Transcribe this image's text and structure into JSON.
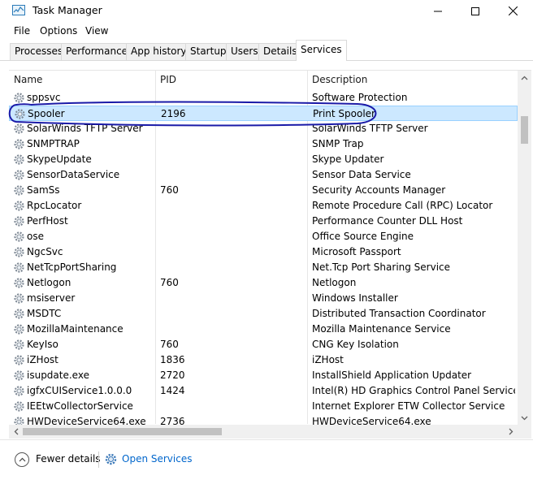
{
  "window": {
    "title": "Task Manager",
    "app_icon": "task-manager-icon",
    "controls": [
      "minimize-icon",
      "maximize-icon",
      "close-icon"
    ]
  },
  "menu": [
    "File",
    "Options",
    "View"
  ],
  "tabs": [
    {
      "label": "Processes",
      "active": false
    },
    {
      "label": "Performance",
      "active": false
    },
    {
      "label": "App history",
      "active": false
    },
    {
      "label": "Startup",
      "active": false
    },
    {
      "label": "Users",
      "active": false
    },
    {
      "label": "Details",
      "active": false
    },
    {
      "label": "Services",
      "active": true
    }
  ],
  "columns": {
    "name": "Name",
    "pid": "PID",
    "description": "Description"
  },
  "services": [
    {
      "name": "sppsvc",
      "pid": "",
      "description": "Software Protection"
    },
    {
      "name": "Spooler",
      "pid": "2196",
      "description": "Print Spooler",
      "selected": true
    },
    {
      "name": "SolarWinds TFTP Server",
      "pid": "",
      "description": "SolarWinds TFTP Server"
    },
    {
      "name": "SNMPTRAP",
      "pid": "",
      "description": "SNMP Trap"
    },
    {
      "name": "SkypeUpdate",
      "pid": "",
      "description": "Skype Updater"
    },
    {
      "name": "SensorDataService",
      "pid": "",
      "description": "Sensor Data Service"
    },
    {
      "name": "SamSs",
      "pid": "760",
      "description": "Security Accounts Manager"
    },
    {
      "name": "RpcLocator",
      "pid": "",
      "description": "Remote Procedure Call (RPC) Locator"
    },
    {
      "name": "PerfHost",
      "pid": "",
      "description": "Performance Counter DLL Host"
    },
    {
      "name": "ose",
      "pid": "",
      "description": "Office  Source Engine"
    },
    {
      "name": "NgcSvc",
      "pid": "",
      "description": "Microsoft Passport"
    },
    {
      "name": "NetTcpPortSharing",
      "pid": "",
      "description": "Net.Tcp Port Sharing Service"
    },
    {
      "name": "Netlogon",
      "pid": "760",
      "description": "Netlogon"
    },
    {
      "name": "msiserver",
      "pid": "",
      "description": "Windows Installer"
    },
    {
      "name": "MSDTC",
      "pid": "",
      "description": "Distributed Transaction Coordinator"
    },
    {
      "name": "MozillaMaintenance",
      "pid": "",
      "description": "Mozilla Maintenance Service"
    },
    {
      "name": "KeyIso",
      "pid": "760",
      "description": "CNG Key Isolation"
    },
    {
      "name": "iZHost",
      "pid": "1836",
      "description": "iZHost"
    },
    {
      "name": "isupdate.exe",
      "pid": "2720",
      "description": "InstallShield Application Updater"
    },
    {
      "name": "igfxCUIService1.0.0.0",
      "pid": "1424",
      "description": "Intel(R) HD Graphics Control Panel Service"
    },
    {
      "name": "IEEtwCollectorService",
      "pid": "",
      "description": "Internet Explorer ETW Collector Service"
    },
    {
      "name": "HWDeviceService64.exe",
      "pid": "2736",
      "description": "HWDeviceService64.exe"
    }
  ],
  "footer": {
    "fewer_details": "Fewer details",
    "open_services": "Open Services"
  },
  "colors": {
    "selection": "#cce8ff",
    "link": "#0066cc",
    "annotation": "#1a1aa8"
  }
}
